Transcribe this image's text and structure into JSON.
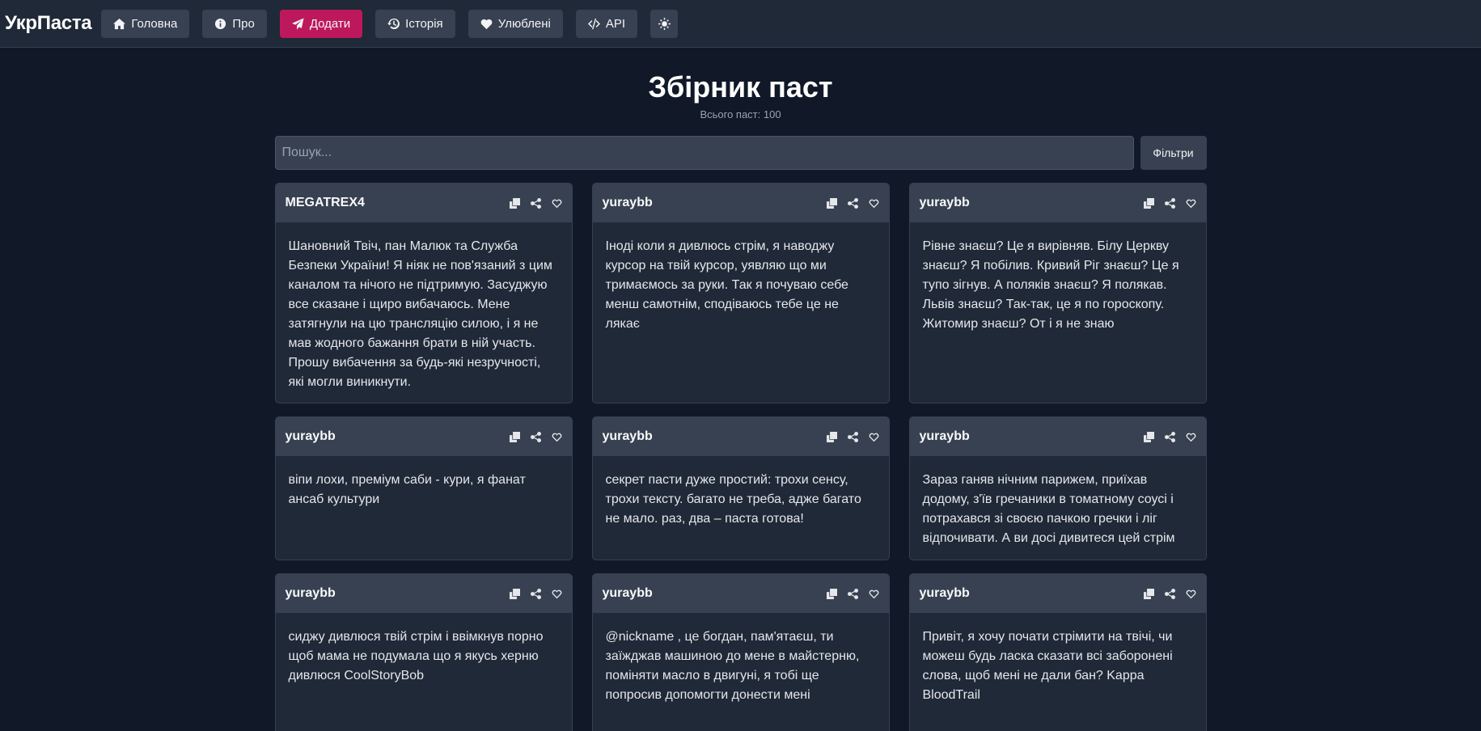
{
  "nav": {
    "brand": "УкрПаста",
    "items": [
      {
        "label": "Головна",
        "icon": "home-icon"
      },
      {
        "label": "Про",
        "icon": "info-icon"
      },
      {
        "label": "Додати",
        "icon": "send-icon",
        "active": true
      },
      {
        "label": "Історія",
        "icon": "history-icon"
      },
      {
        "label": "Улюблені",
        "icon": "heart-icon"
      },
      {
        "label": "API",
        "icon": "code-icon"
      }
    ],
    "theme_icon": "sun-icon"
  },
  "page": {
    "title": "Збірник паст",
    "count_text": "Всього паст: 100"
  },
  "search": {
    "placeholder": "Пошук...",
    "filter_label": "Фільтри"
  },
  "cards": [
    {
      "author": "MEGATREX4",
      "text": "Шановний Твіч, пан Малюк та Служба Безпеки України! Я ніяк не пов'язаний з цим каналом та нічого не підтримую. Засуджую все сказане і щиро вибачаюсь. Мене затягнули на цю трансляцію силою, і я не мав жодного бажання брати в ній участь. Прошу вибачення за будь-які незручності, які могли виникнути."
    },
    {
      "author": "yuraybb",
      "text": "Іноді коли я дивлюсь стрім, я наводжу курсор на твій курсор, уявляю що ми тримаємось за руки. Так я почуваю себе менш самотнім, сподіваюсь тебе це не лякає"
    },
    {
      "author": "yuraybb",
      "text": "Рівне знаєш? Це я вирівняв. Білу Церкву знаєш? Я побілив. Кривий Ріг знаєш? Це я тупо зігнув. А поляків знаєш? Я полякав. Львів знаєш? Так-так, це я по гороскопу. Житомир знаєш? От і я не знаю"
    },
    {
      "author": "yuraybb",
      "text": "віпи лохи, преміум саби - кури, я фанат ансаб культури"
    },
    {
      "author": "yuraybb",
      "text": "секрет пасти дуже простий: трохи сенсу, трохи тексту. багато не треба, адже багато не мало. раз, два – паста готова!"
    },
    {
      "author": "yuraybb",
      "text": "Зараз ганяв нічним парижем, приїхав додому, з'їв гречаники в томатному соусі і потрахався зі своєю пачкою гречки і ліг відпочивати. А ви досі дивитеся цей стрім"
    },
    {
      "author": "yuraybb",
      "text": "сиджу дивлюся твій стрім і ввімкнув порно щоб мама не подумала що я якусь херню дивлюся CoolStoryBob"
    },
    {
      "author": "yuraybb",
      "text": "@nickname , це богдан, пам'ятаєш, ти заїжджав машиною до мене в майстерню, поміняти масло в двигуні, я тобі ще попросив допомогти донести мені"
    },
    {
      "author": "yuraybb",
      "text": "Привіт, я хочу почати стрімити на твічі, чи можеш будь ласка сказати всі заборонені слова, щоб мені не дали бан? Kappa BloodTrail"
    }
  ],
  "card_actions": [
    "copy-icon",
    "share-icon",
    "heart-icon"
  ]
}
